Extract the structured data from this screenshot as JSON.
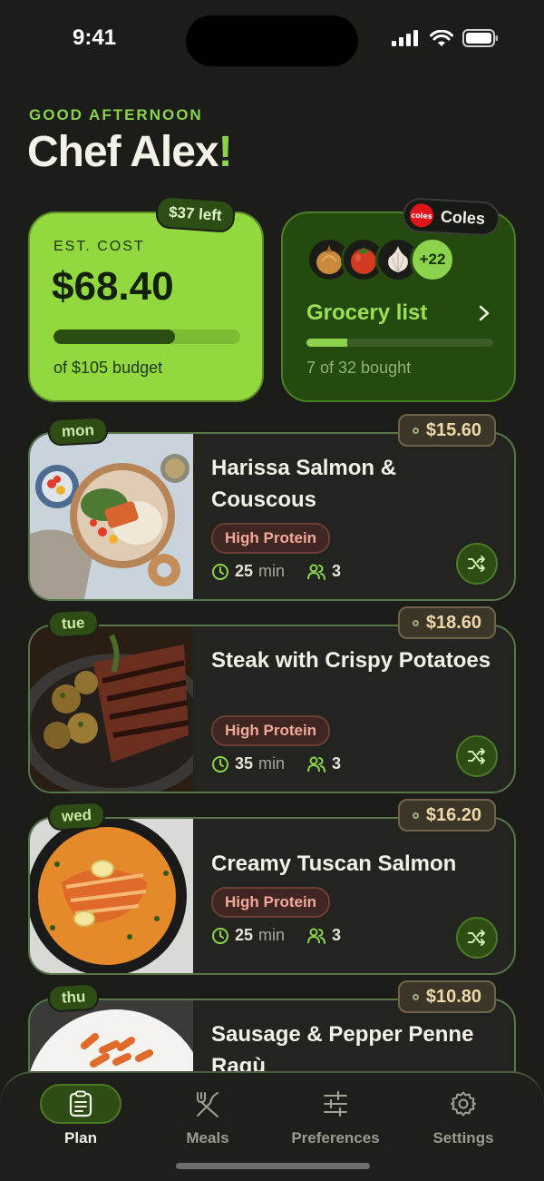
{
  "status_bar": {
    "time": "9:41"
  },
  "greeting": {
    "subtitle": "GOOD AFTERNOON",
    "name": "Chef Alex",
    "punct": "!"
  },
  "budget": {
    "pill": "$37 left",
    "label": "EST. COST",
    "value": "$68.40",
    "progress": 0.65,
    "sub": "of $105 budget"
  },
  "grocery": {
    "store": "Coles",
    "store_logo_text": "coles",
    "produce_icons": [
      "onion-icon",
      "tomato-icon",
      "garlic-icon"
    ],
    "more": "+22",
    "title": "Grocery list",
    "progress": 0.219,
    "sub": "7 of 32 bought"
  },
  "meals": [
    {
      "day": "mon",
      "price": "$15.60",
      "title": "Harissa Salmon & Couscous",
      "tag": "High Protein",
      "time": "25",
      "time_unit": "min",
      "servings": "3"
    },
    {
      "day": "tue",
      "price": "$18.60",
      "title": "Steak with Crispy Potatoes",
      "tag": "High Protein",
      "time": "35",
      "time_unit": "min",
      "servings": "3"
    },
    {
      "day": "wed",
      "price": "$16.20",
      "title": "Creamy Tuscan Salmon",
      "tag": "High Protein",
      "time": "25",
      "time_unit": "min",
      "servings": "3"
    },
    {
      "day": "thu",
      "price": "$10.80",
      "title": "Sausage & Pepper Penne Ragù"
    }
  ],
  "tabs": [
    {
      "label": "Plan",
      "icon": "clipboard-icon",
      "active": true
    },
    {
      "label": "Meals",
      "icon": "utensils-icon",
      "active": false
    },
    {
      "label": "Preferences",
      "icon": "sliders-icon",
      "active": false
    },
    {
      "label": "Settings",
      "icon": "gear-icon",
      "active": false
    }
  ],
  "colors": {
    "accent": "#8bd34c",
    "background": "#1c1d19",
    "budget_card": "#92d83f",
    "grocery_card": "#244a0f"
  }
}
